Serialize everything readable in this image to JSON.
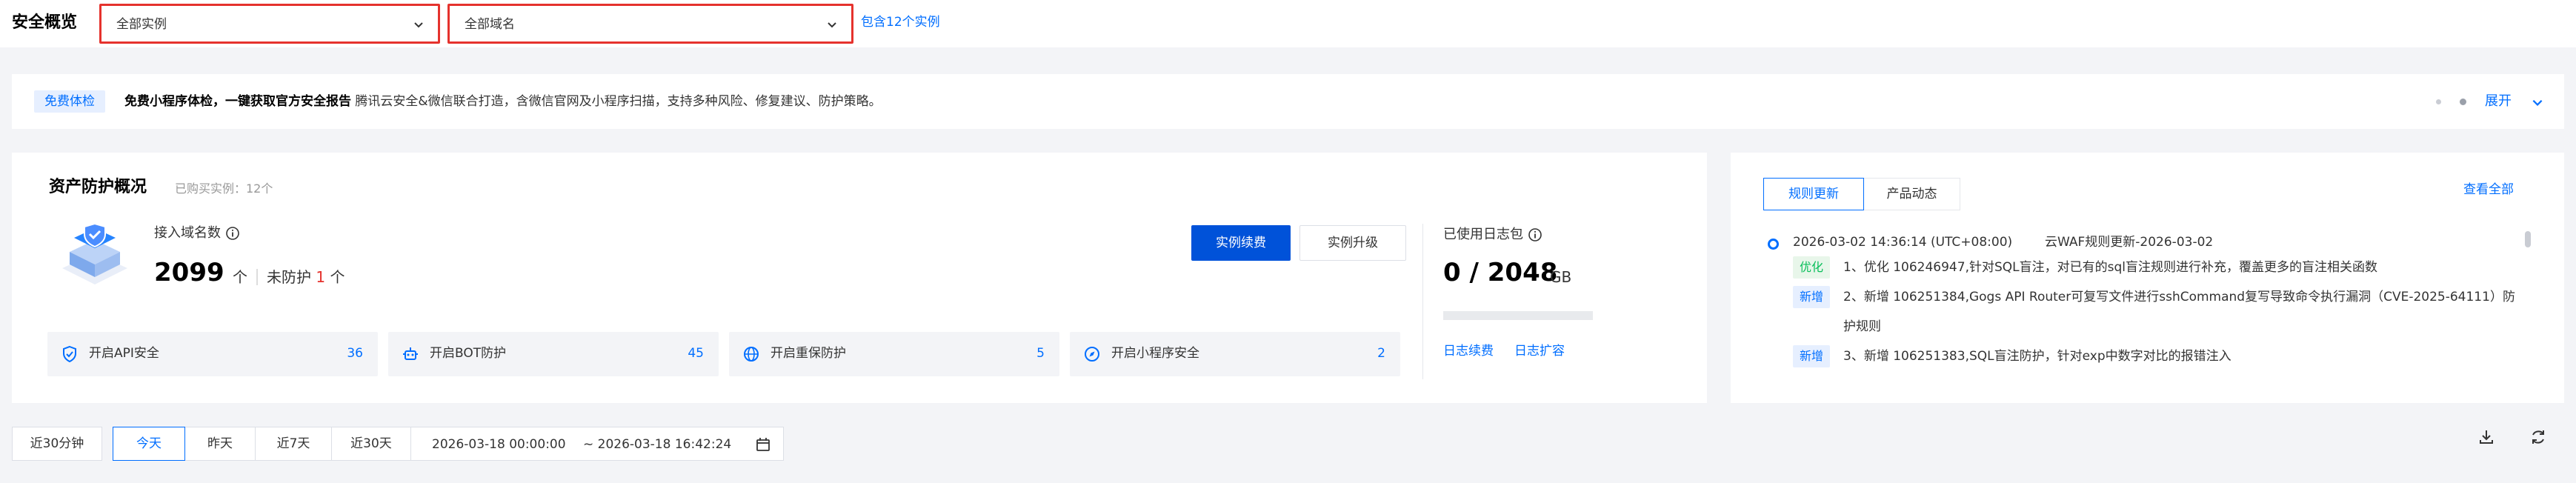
{
  "header": {
    "title": "安全概览",
    "instance_select": "全部实例",
    "domain_select": "全部域名",
    "instance_link": "包含12个实例"
  },
  "banner": {
    "badge": "免费体检",
    "headline": "免费小程序体检，一键获取官方安全报告",
    "text": "腾讯云安全&微信联合打造，含微信官网及小程序扫描，支持多种风险、修复建议、防护策略。",
    "expand": "展开"
  },
  "asset": {
    "title": "资产防护概况",
    "subtitle": "已购买实例：12个",
    "domain_label": "接入域名数",
    "domain_count": "2099",
    "domain_unit": "个",
    "unprotected_label": "未防护",
    "unprotected_count": "1",
    "unprotected_unit": "个",
    "renew_button": "实例续费",
    "upgrade_button": "实例升级",
    "features": [
      {
        "label": "开启API安全",
        "count": "36"
      },
      {
        "label": "开启BOT防护",
        "count": "45"
      },
      {
        "label": "开启重保防护",
        "count": "5"
      },
      {
        "label": "开启小程序安全",
        "count": "2"
      }
    ],
    "log": {
      "title": "已使用日志包",
      "value": "0 / 2048",
      "unit": "GB",
      "used_fraction": 0,
      "renew_link": "日志续费",
      "expand_link": "日志扩容"
    }
  },
  "rules": {
    "tabs": [
      "规则更新",
      "产品动态"
    ],
    "view_all": "查看全部",
    "entry": {
      "date": "2026-03-02 14:36:14 (UTC+08:00)",
      "heading": "云WAF规则更新-2026-03-02",
      "items": [
        {
          "tag": "优化",
          "text": "1、优化 106246947,针对SQL盲注，对已有的sql盲注规则进行补充，覆盖更多的盲注相关函数"
        },
        {
          "tag": "新增",
          "text": "2、新增 106251384,Gogs API Router可复写文件进行sshCommand复写导致命令执行漏洞（CVE-2025-64111）防护规则"
        },
        {
          "tag": "新增",
          "text": "3、新增 106251383,SQL盲注防护，针对exp中数字对比的报错注入"
        }
      ]
    }
  },
  "time_filter": {
    "options": [
      "近30分钟",
      "今天",
      "昨天",
      "近7天",
      "近30天"
    ],
    "selected": "今天",
    "range_start": "2026-03-18 00:00:00",
    "range_end": "~ 2026-03-18 16:42:24"
  },
  "colors": {
    "brand": "#006eff",
    "primary_button": "#0052d9",
    "alert": "#e5322d",
    "optimize_tag": "#0abf5b"
  },
  "icons": {
    "select_arrow": "chevron-down-icon",
    "info": "info-circle-icon",
    "api": "shield-icon",
    "bot": "robot-icon",
    "vip": "globe-icon",
    "miniprogram": "compass-icon",
    "date": "calendar-icon",
    "download": "download-icon",
    "refresh": "refresh-icon"
  }
}
